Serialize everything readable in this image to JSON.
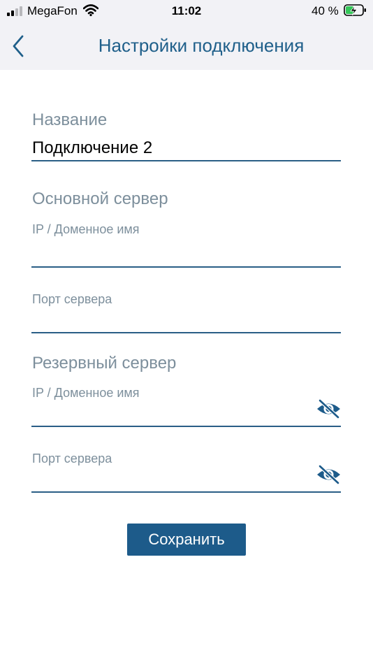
{
  "status_bar": {
    "carrier": "MegaFon",
    "time": "11:02",
    "battery_percent": "40 %",
    "signal_icon": "cellular-signal-icon",
    "wifi_icon": "wifi-icon",
    "battery_icon": "battery-charging-icon"
  },
  "nav": {
    "back_icon": "chevron-left-icon",
    "title": "Настройки подключения"
  },
  "form": {
    "name_label": "Название",
    "name_value": "Подключение 2",
    "primary_section": "Основной сервер",
    "primary_ip_placeholder": "IP / Доменное имя",
    "primary_port_placeholder": "Порт сервера",
    "backup_section": "Резервный сервер",
    "backup_ip_placeholder": "IP / Доменное имя",
    "backup_port_placeholder": "Порт сервера",
    "eye_icon": "eye-slash-icon"
  },
  "save_label": "Сохранить",
  "colors": {
    "accent": "#1f5f8a",
    "button": "#1d5b8a",
    "label": "#7d8f9c",
    "header_bg": "#f2f2f6"
  }
}
